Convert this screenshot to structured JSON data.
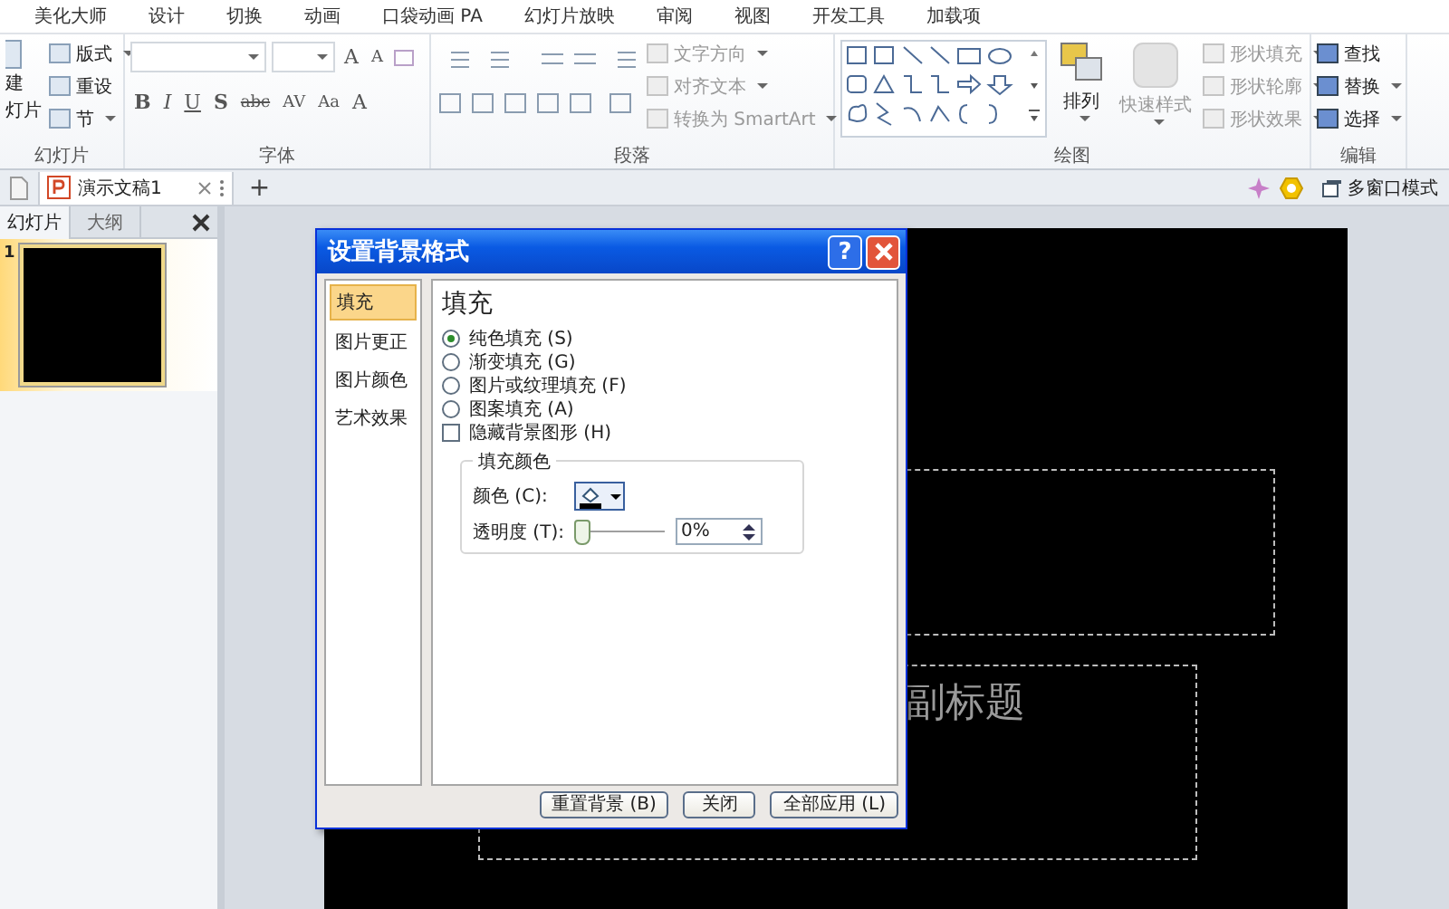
{
  "ribbon_tabs": [
    {
      "label": "美化大师",
      "selected": false
    },
    {
      "label": "设计",
      "selected": false
    },
    {
      "label": "切换",
      "selected": false
    },
    {
      "label": "动画",
      "selected": false
    },
    {
      "label": "口袋动画 PA",
      "selected": false
    },
    {
      "label": "幻灯片放映",
      "selected": false
    },
    {
      "label": "审阅",
      "selected": false
    },
    {
      "label": "视图",
      "selected": false
    },
    {
      "label": "开发工具",
      "selected": false
    },
    {
      "label": "加载项",
      "selected": false
    }
  ],
  "slides_group": {
    "label": "幻灯片",
    "new_slide": [
      "建",
      "灯片"
    ],
    "buttons": [
      {
        "label": "版式",
        "dropdown": true,
        "disabled": false
      },
      {
        "label": "重设",
        "dropdown": false,
        "disabled": false
      },
      {
        "label": "节",
        "dropdown": true,
        "disabled": false
      }
    ]
  },
  "font_group": {
    "label": "字体",
    "size_buttons": [
      "A",
      "A"
    ],
    "format_buttons": [
      "B",
      "I",
      "U",
      "S",
      "abc",
      "AV",
      "Aa",
      "A"
    ]
  },
  "paragraph_group": {
    "label": "段落",
    "buttons": [
      {
        "label": "文字方向",
        "dropdown": true,
        "disabled": true
      },
      {
        "label": "对齐文本",
        "dropdown": true,
        "disabled": true
      },
      {
        "label": "转换为 SmartArt",
        "dropdown": true,
        "disabled": true
      }
    ]
  },
  "drawing_group": {
    "label": "绘图",
    "arrange": "排列",
    "quick_styles": "快速样式",
    "buttons": [
      {
        "label": "形状填充",
        "dropdown": true,
        "disabled": true
      },
      {
        "label": "形状轮廓",
        "dropdown": true,
        "disabled": true
      },
      {
        "label": "形状效果",
        "dropdown": true,
        "disabled": true
      }
    ]
  },
  "editing_group": {
    "label": "编辑",
    "buttons": [
      {
        "label": "查找",
        "dropdown": false,
        "disabled": false
      },
      {
        "label": "替换",
        "dropdown": true,
        "disabled": false
      },
      {
        "label": "选择",
        "dropdown": true,
        "disabled": false
      }
    ]
  },
  "document_tab": {
    "title": "演示文稿1",
    "selected": true
  },
  "new_tab": "+",
  "window_mode": "多窗口模式",
  "panel_tabs": [
    {
      "label": "幻灯片",
      "selected": true
    },
    {
      "label": "大纲",
      "selected": false
    }
  ],
  "slides": [
    {
      "number": "1",
      "selected": true
    }
  ],
  "slide": {
    "subtitle_placeholder": "副标题"
  },
  "dialog": {
    "title": "设置背景格式",
    "help": "?",
    "nav": [
      {
        "label": "填充",
        "selected": true
      },
      {
        "label": "图片更正",
        "selected": false
      },
      {
        "label": "图片颜色",
        "selected": false
      },
      {
        "label": "艺术效果",
        "selected": false
      }
    ],
    "heading": "填充",
    "fill_options": [
      {
        "label": "纯色填充 (S)",
        "selected": true
      },
      {
        "label": "渐变填充 (G)",
        "selected": false
      },
      {
        "label": "图片或纹理填充 (F)",
        "selected": false
      },
      {
        "label": "图案填充 (A)",
        "selected": false
      }
    ],
    "hide_graphics": {
      "label": "隐藏背景图形 (H)",
      "checked": false
    },
    "fill_color": {
      "legend": "填充颜色",
      "color_label": "颜色 (C):",
      "transparency_label": "透明度 (T):",
      "transparency": {
        "level": 0
      },
      "transparency_value": "0%"
    },
    "buttons": [
      "重置背景 (B)",
      "关闭",
      "全部应用 (L)"
    ]
  }
}
